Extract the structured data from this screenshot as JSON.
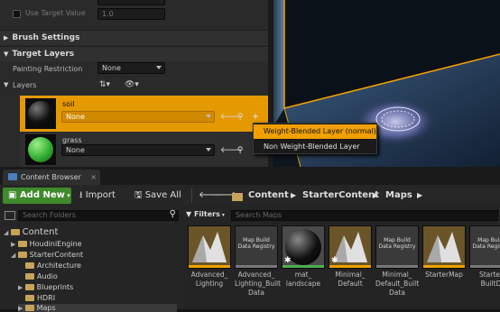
{
  "details": {
    "use_target_value_label": "Use Target Value",
    "use_target_value_field": "1.0",
    "brush_settings": "Brush Settings",
    "target_layers": "Target Layers",
    "painting_restriction_label": "Painting Restriction",
    "painting_restriction_value": "None",
    "layers_label": "Layers",
    "layers": [
      {
        "name": "soil",
        "value": "None",
        "color": "#111111"
      },
      {
        "name": "grass",
        "value": "None",
        "color": "#33b033"
      }
    ]
  },
  "context_menu": {
    "items": [
      "Weight-Blended Layer (normal)",
      "Non Weight-Blended Layer"
    ]
  },
  "content_browser": {
    "tab": "Content Browser",
    "add_new": "Add New",
    "import": "Import",
    "save_all": "Save All",
    "breadcrumb": [
      "Content",
      "StarterContent",
      "Maps"
    ],
    "search_folders": "Search Folders",
    "filters": "Filters",
    "search_maps": "Search Maps",
    "tree": [
      {
        "label": "Content",
        "indent": 0
      },
      {
        "label": "HoudiniEngine",
        "indent": 1
      },
      {
        "label": "StarterContent",
        "indent": 1
      },
      {
        "label": "Architecture",
        "indent": 2
      },
      {
        "label": "Audio",
        "indent": 2
      },
      {
        "label": "Blueprints",
        "indent": 2
      },
      {
        "label": "HDRI",
        "indent": 2
      },
      {
        "label": "Maps",
        "indent": 2
      }
    ],
    "assets": [
      {
        "name": "Advanced_\nLighting",
        "thumb": "map"
      },
      {
        "name": "Advanced_\nLighting_Built\nData",
        "thumb": "Map Build\nData Registry"
      },
      {
        "name": "mat_\nlandscape",
        "thumb": "sphere"
      },
      {
        "name": "Minimal_\nDefault",
        "thumb": "map"
      },
      {
        "name": "Minimal_\nDefault_Built\nData",
        "thumb": "Map Build\nData Registry"
      },
      {
        "name": "StarterMap",
        "thumb": "map"
      },
      {
        "name": "Starter\nBuiltD",
        "thumb": "Map Build\nData Registry"
      }
    ]
  },
  "colors": {
    "accent": "#f0a000",
    "green": "#3f8a2a"
  }
}
